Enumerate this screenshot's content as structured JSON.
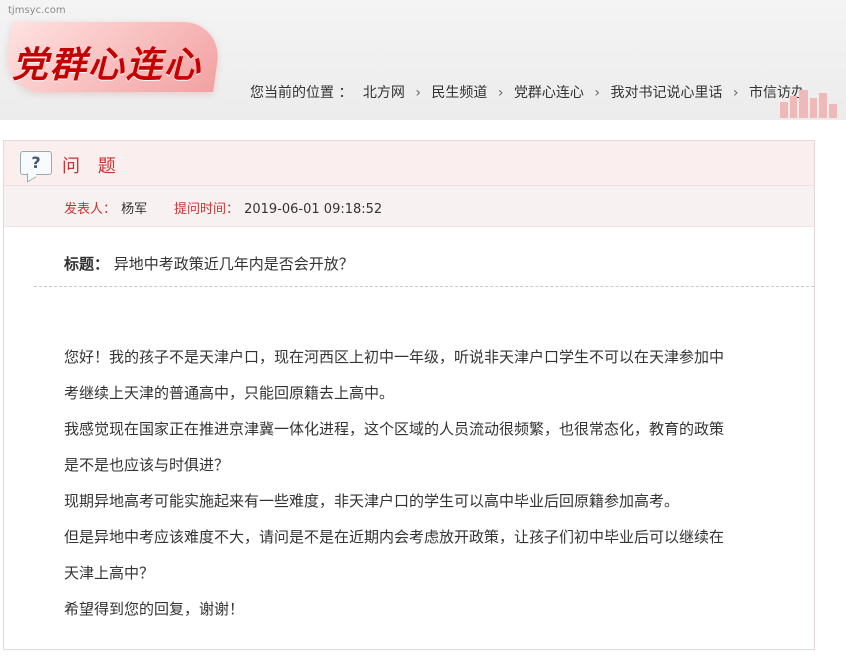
{
  "watermark": "tjmsyc.com",
  "brand": {
    "logo_text": "党群心连心"
  },
  "breadcrumb": {
    "label": "您当前的位置 ：",
    "items": [
      "北方网",
      "民生频道",
      "党群心连心",
      "我对书记说心里话",
      "市信访办"
    ]
  },
  "question": {
    "title": "问 题",
    "poster_label": "发表人：",
    "poster_name": "杨军",
    "time_label": "提问时间：",
    "time_value": "2019-06-01 09:18:52",
    "subject_label": "标题：",
    "subject_text": "异地中考政策近几年内是否会开放？",
    "paragraphs": [
      "您好！我的孩子不是天津户口，现在河西区上初中一年级，听说非天津户口学生不可以在天津参加中",
      "考继续上天津的普通高中，只能回原籍去上高中。",
      "我感觉现在国家正在推进京津冀一体化进程，这个区域的人员流动很频繁，也很常态化，教育的政策",
      "是不是也应该与时俱进？",
      "现期异地高考可能实施起来有一些难度，非天津户口的学生可以高中毕业后回原籍参加高考。",
      "但是异地中考应该难度不大，请问是不是在近期内会考虑放开政策，让孩子们初中毕业后可以继续在",
      "天津上高中？",
      "希望得到您的回复，谢谢！"
    ]
  },
  "colors": {
    "accent": "#c33333",
    "header_bg": "#fbeeee"
  }
}
